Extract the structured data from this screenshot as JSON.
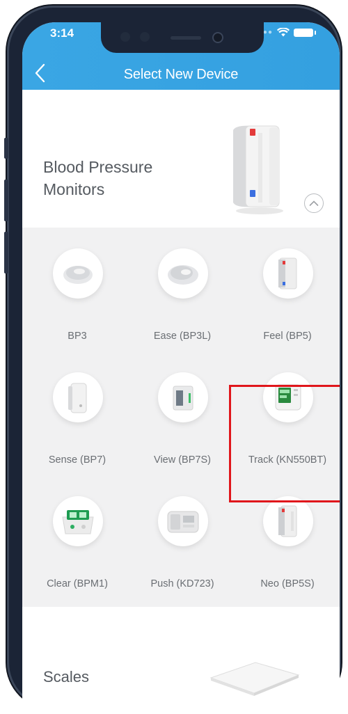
{
  "status_bar": {
    "time": "3:14"
  },
  "header": {
    "title": "Select New Device"
  },
  "category": {
    "label": "Blood Pressure Monitors"
  },
  "devices": [
    {
      "label": "BP3"
    },
    {
      "label": "Ease (BP3L)"
    },
    {
      "label": "Feel (BP5)"
    },
    {
      "label": "Sense (BP7)"
    },
    {
      "label": "View (BP7S)"
    },
    {
      "label": "Track (KN550BT)"
    },
    {
      "label": "Clear (BPM1)"
    },
    {
      "label": "Push (KD723)"
    },
    {
      "label": "Neo (BP5S)"
    }
  ],
  "next_category": {
    "label": "Scales"
  },
  "colors": {
    "header_blue": "#3aa6e4",
    "grid_background": "#f1f1f2",
    "highlight_red": "#e0161b",
    "label_gray": "#6a6e73"
  },
  "icons": {
    "back": "chevron-left-icon",
    "collapse": "chevron-up-circle-icon",
    "wifi": "wifi-icon",
    "battery": "battery-icon"
  }
}
